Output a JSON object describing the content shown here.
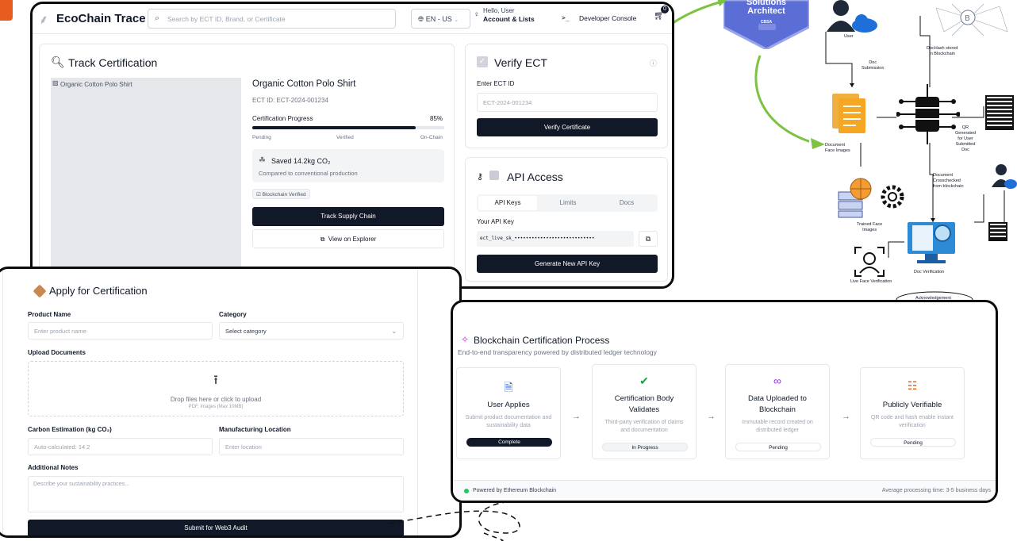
{
  "header": {
    "brand": "EcoChain Trace",
    "search_placeholder": "Search by ECT ID, Brand, or Certificate",
    "language": "EN - US",
    "greeting": "Hello, User",
    "account": "Account & Lists",
    "dev_console": "Developer Console",
    "cart_count": "0"
  },
  "track": {
    "title": "Track Certification",
    "image_alt": "Organic Cotton Polo Shirt",
    "product_name": "Organic Cotton Polo Shirt",
    "ect_id": "ECT ID: ECT-2024-001234",
    "progress_label": "Certification Progress",
    "progress_text": "85%",
    "progress_value": 0.85,
    "stages": [
      "Pending",
      "Verified",
      "On-Chain"
    ],
    "saved_title": "Saved 14.2kg CO₂",
    "saved_sub": "Compared to conventional production",
    "badge": "Blockchain Verified",
    "track_btn": "Track Supply Chain",
    "explorer_btn": "View on Explorer"
  },
  "verify": {
    "title": "Verify ECT",
    "field_label": "Enter ECT ID",
    "placeholder": "ECT-2024-001234",
    "button": "Verify Certificate"
  },
  "api": {
    "title": "API Access",
    "tabs": [
      "API Keys",
      "Limits",
      "Docs"
    ],
    "key_label": "Your API Key",
    "key_value": "ect_live_sk_••••••••••••••••••••••••••••",
    "generate_btn": "Generate New API Key"
  },
  "apply": {
    "title": "Apply for Certification",
    "product_label": "Product Name",
    "product_placeholder": "Enter product name",
    "category_label": "Category",
    "category_placeholder": "Select category",
    "upload_label": "Upload Documents",
    "upload_text": "Drop files here or click to upload",
    "upload_sub": "PDF, Images (Max 10MB)",
    "carbon_label": "Carbon Estimation (kg CO₂)",
    "carbon_placeholder": "Auto-calculated: 14.2",
    "location_label": "Manufacturing Location",
    "location_placeholder": "Enter location",
    "notes_label": "Additional Notes",
    "notes_placeholder": "Describe your sustainability practices...",
    "submit_btn": "Submit for Web3 Audit"
  },
  "process": {
    "title": "Blockchain Certification Process",
    "subtitle": "End-to-end transparency powered by distributed ledger technology",
    "steps": [
      {
        "title": "User Applies",
        "desc": "Submit product documentation and sustainability data",
        "status": "Complete"
      },
      {
        "title": "Certification Body Validates",
        "desc": "Third-party verification of claims and documentation",
        "status": "In Progress"
      },
      {
        "title": "Data Uploaded to Blockchain",
        "desc": "Immutable record created on distributed ledger",
        "status": "Pending"
      },
      {
        "title": "Publicly Verifiable",
        "desc": "QR code and hash enable instant verification",
        "status": "Pending"
      }
    ],
    "footer_left": "Powered by Ethereum Blockchain",
    "footer_right": "Average processing time: 3-5 business days"
  },
  "diagram": {
    "badge_line1": "Solutions",
    "badge_line2": "Architect",
    "badge_line3": "CBSA",
    "user_top": "User",
    "doc_submission": "Doc\nSubmission",
    "doc_hash": "DocHash stored\nin Blockchain",
    "document_face": "Document\nFace Images",
    "qr_generated": "QR\nGenerated\nfor User\nSubmitted\nDoc",
    "document_cross": "Document\nCrosschecked\nfrom blockchain",
    "trained_face": "Trained Face\nImages",
    "live_face": "Live Face Verification",
    "doc_verification": "Doc Verification",
    "acknowledgement": "Acknowledgement"
  }
}
